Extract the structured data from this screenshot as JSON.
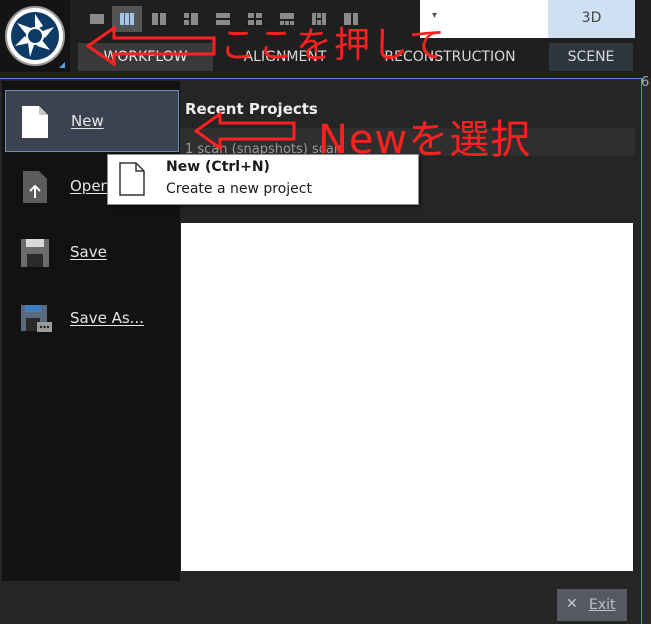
{
  "toolbar": {
    "view_dropdown_caret": "▾",
    "view_3d_label": "3D",
    "layout_buttons": [
      "layout-1",
      "layout-2",
      "layout-3",
      "layout-4",
      "layout-5",
      "layout-6",
      "layout-7",
      "layout-8",
      "layout-9"
    ]
  },
  "tabs": [
    "WORKFLOW",
    "ALIGNMENT",
    "RECONSTRUCTION",
    "SCENE"
  ],
  "sidebar": {
    "items": [
      {
        "label": "New",
        "icon": "new-document-icon"
      },
      {
        "label": "Open...",
        "icon": "open-document-icon"
      },
      {
        "label": "Save",
        "icon": "save-icon"
      },
      {
        "label": "Save As...",
        "icon": "save-as-icon"
      }
    ]
  },
  "recent": {
    "title": "Recent Projects",
    "subtitle": "1 scan (snapshots) scan"
  },
  "tooltip": {
    "title": "New (Ctrl+N)",
    "description": "Create a new project"
  },
  "exit_button": {
    "label": "Exit",
    "icon": "close-icon"
  },
  "right_edge_text": "6",
  "annotations": {
    "click_here": "ここを押して",
    "select_new": "Newを選択",
    "color": "#ff2020"
  },
  "colors": {
    "accent": "#4a90d9",
    "background": "#252525",
    "sidebar": "#121212",
    "selected_item": "#3b4350"
  }
}
